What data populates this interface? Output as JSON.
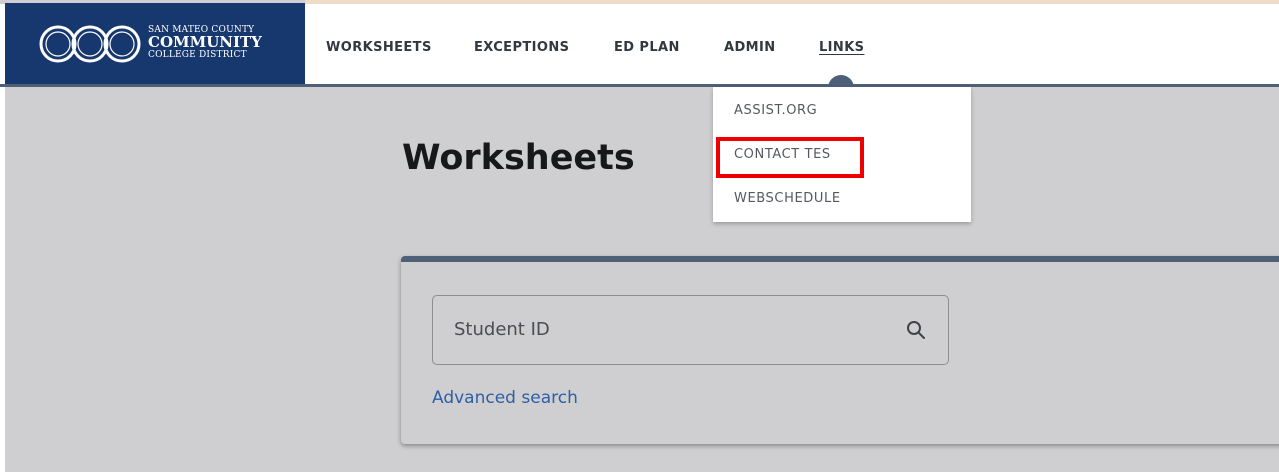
{
  "logo": {
    "line1": "SAN MATEO COUNTY",
    "line2": "COMMUNITY",
    "line3": "COLLEGE DISTRICT"
  },
  "nav": {
    "worksheets": "WORKSHEETS",
    "exceptions": "EXCEPTIONS",
    "ed_plan": "ED PLAN",
    "admin": "ADMIN",
    "links": "LINKS"
  },
  "links_menu": {
    "items": [
      "ASSIST.ORG",
      "CONTACT TES",
      "WEBSCHEDULE"
    ]
  },
  "page": {
    "title": "Worksheets"
  },
  "search": {
    "placeholder": "Student ID",
    "advanced_label": "Advanced search"
  },
  "colors": {
    "brand_navy": "#17386f",
    "accent_slate": "#4e5f78",
    "highlight_red": "#ef0000",
    "link_blue": "#2d5fa6"
  },
  "icons": {
    "logo": "interlocking-rings-logo-icon",
    "search": "search-icon",
    "nav_active": "active-tab-indicator"
  }
}
